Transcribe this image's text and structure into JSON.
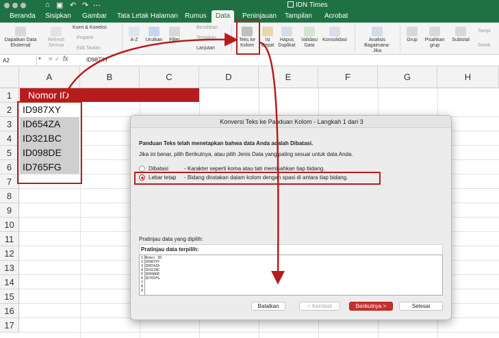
{
  "window": {
    "title": "IDN Times"
  },
  "tabs": [
    "Beranda",
    "Sisipkan",
    "Gambar",
    "Tata Letak Halaman",
    "Rumus",
    "Data",
    "Peninjauan",
    "Tampilan",
    "Acrobat"
  ],
  "active_tab": "Data",
  "ribbon": {
    "get_external": "Dapatkan Data Eksternal",
    "refresh_all": "Refresh Semua",
    "queries": "Kueri & Koneksi",
    "properties": "Properti",
    "edit_links": "Edit Tautan",
    "sort_az": "A-Z",
    "sort": "Urutkan",
    "filter": "Filter",
    "clear": "Bersihkan",
    "reapply": "Terapkan",
    "advanced": "Lanjutan",
    "text_to_columns": "Teks ke Kolom",
    "flash_fill": "Isi Cepat",
    "remove_dupes": "Hapus Duplikat",
    "validation": "Validasi Data",
    "consolidate": "Konsolidasi",
    "whatif": "Analisis Bagaimana-Jika",
    "group": "Grup",
    "ungroup": "Pisahkan grup",
    "subtotal": "Subtotal",
    "show_detail": "Tampi",
    "hide_detail": "Semb"
  },
  "formula_bar": {
    "name_box": "A2",
    "fx": "fx",
    "value": "ID987XY"
  },
  "grid": {
    "columns": [
      "A",
      "B",
      "C",
      "D",
      "E",
      "F",
      "G",
      "H"
    ],
    "rows": [
      "1",
      "2",
      "3",
      "4",
      "5",
      "6",
      "7",
      "8",
      "9",
      "10",
      "11",
      "12",
      "13",
      "14",
      "15",
      "16",
      "17"
    ],
    "header_cell": "Nomor ID",
    "values": [
      "ID987XY",
      "ID654ZA",
      "ID321BC",
      "ID098DE",
      "ID765FG"
    ]
  },
  "dialog": {
    "title": "Konversi Teks ke Panduan Kolom - Langkah 1 dari 3",
    "heading": "Panduan Teks telah menetapkan bahwa data Anda adalah Dibatasi.",
    "instructions": "Jika ini benar, pilih Berikutnya, atau pilih Jenis Data yang paling sesuai untuk data Anda.",
    "option_delimited_label": "Dibatasi",
    "option_delimited_desc": "- Karakter seperti koma atau tab memisahkan tiap bidang.",
    "option_fixed_label": "Lebar tetap",
    "option_fixed_desc": "- Bidang diratakan dalam kolom dengan spasi di antara tiap bidang.",
    "preview_label": "Pratinjau data yang dipilih:",
    "preview_header": "Pratinjau data terpilih:",
    "preview_rows": [
      "1 Nomor ID",
      "2 ID987XY",
      "3 ID654ZA",
      "4 ID321BC",
      "5 ID098DE",
      "6 ID765FG",
      "7",
      "8",
      "9"
    ],
    "buttons": {
      "cancel": "Batalkan",
      "back": "< Kembali",
      "next": "Berikutnya >",
      "finish": "Selesai"
    }
  },
  "colors": {
    "excel_green": "#1f7144",
    "annotation_red": "#b71c1c",
    "primary_button": "#c9302c"
  }
}
